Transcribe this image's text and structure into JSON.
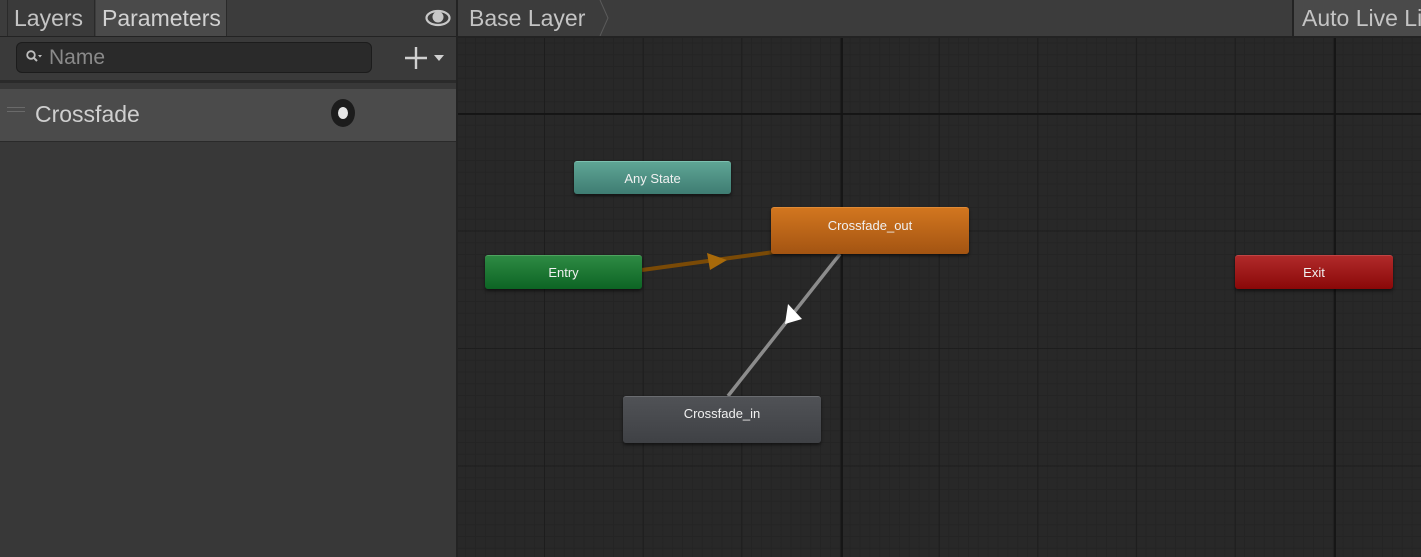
{
  "left_panel": {
    "tabs": [
      {
        "label": "Layers",
        "active": false
      },
      {
        "label": "Parameters",
        "active": true
      }
    ],
    "eye_icon": "eye-icon",
    "search": {
      "placeholder": "Name",
      "value": "",
      "icon": "search-icon"
    },
    "add_button_icon": "plus-dropdown-icon",
    "parameters": [
      {
        "name": "Crossfade",
        "type": "trigger",
        "value": false
      }
    ]
  },
  "graph": {
    "breadcrumb": [
      "Base Layer"
    ],
    "auto_live_link_label": "Auto Live Link",
    "states": [
      {
        "id": "any",
        "label": "Any State",
        "kind": "any",
        "color": "#4f9184"
      },
      {
        "id": "entry",
        "label": "Entry",
        "kind": "entry",
        "color": "#1e7a34"
      },
      {
        "id": "crossfade_out",
        "label": "Crossfade_out",
        "kind": "default",
        "color": "#c06a1a"
      },
      {
        "id": "crossfade_in",
        "label": "Crossfade_in",
        "kind": "normal",
        "color": "#484a4e"
      },
      {
        "id": "exit",
        "label": "Exit",
        "kind": "exit",
        "color": "#9c1818"
      }
    ],
    "transitions": [
      {
        "from": "Entry",
        "to": "Crossfade_out",
        "color": "#7a4a06"
      },
      {
        "from": "Crossfade_out",
        "to": "Crossfade_in",
        "color": "#8a8a8a"
      }
    ]
  }
}
